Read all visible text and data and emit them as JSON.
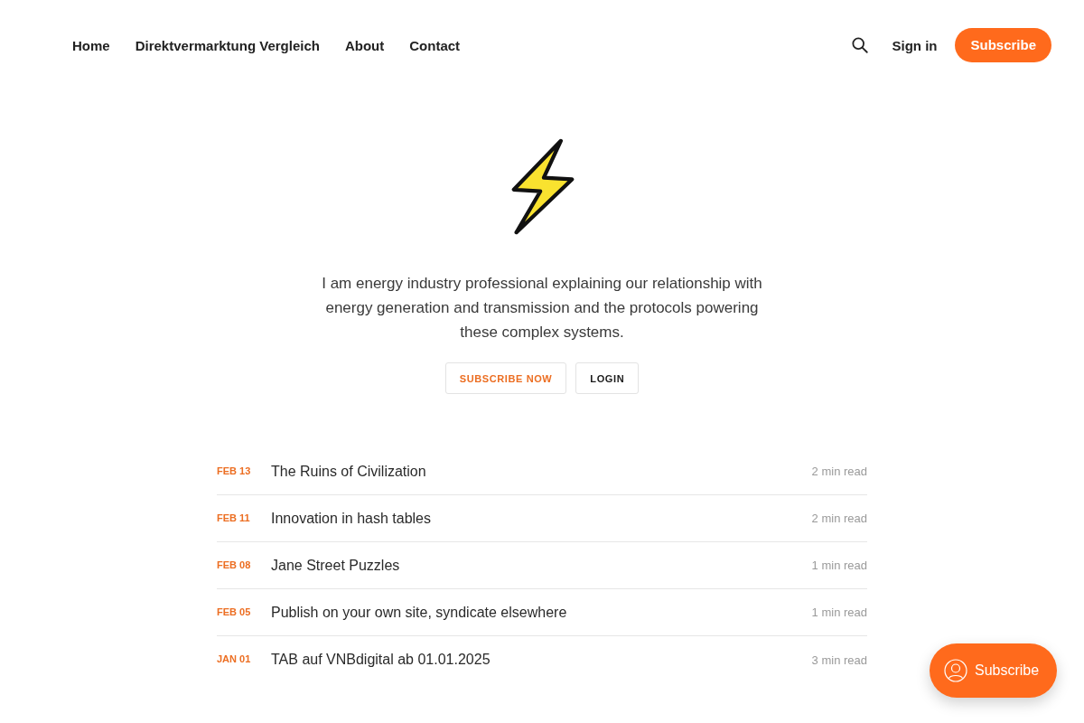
{
  "nav": {
    "links": [
      "Home",
      "Direktvermarktung Vergleich",
      "About",
      "Contact"
    ]
  },
  "header_actions": {
    "sign_in": "Sign in",
    "subscribe": "Subscribe"
  },
  "hero": {
    "description": "I am energy industry professional explaining our relationship with energy generation and transmission and the protocols powering these complex systems.",
    "buttons": [
      {
        "label": "SUBSCRIBE NOW",
        "kind": "primary"
      },
      {
        "label": "LOGIN",
        "kind": "secondary"
      }
    ]
  },
  "posts": [
    {
      "date": "FEB 13",
      "title": "The Ruins of Civilization",
      "read_time": "2 min read"
    },
    {
      "date": "FEB 11",
      "title": "Innovation in hash tables",
      "read_time": "2 min read"
    },
    {
      "date": "FEB 08",
      "title": "Jane Street Puzzles",
      "read_time": "1 min read"
    },
    {
      "date": "FEB 05",
      "title": "Publish on your own site, syndicate elsewhere",
      "read_time": "1 min read"
    },
    {
      "date": "JAN 01",
      "title": "TAB auf VNBdigital ab 01.01.2025",
      "read_time": "3 min read"
    }
  ],
  "floating_button": {
    "label": "Subscribe"
  }
}
